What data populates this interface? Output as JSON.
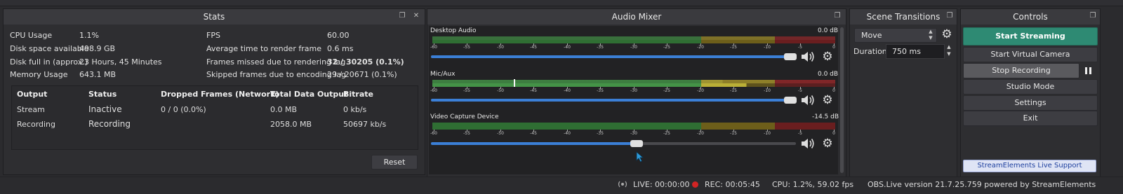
{
  "stats": {
    "title": "Stats",
    "left": [
      {
        "label": "CPU Usage",
        "value": "1.1%"
      },
      {
        "label": "Disk space available",
        "value": "498.9 GB"
      },
      {
        "label": "Disk full in (approx.)",
        "value": "23 Hours, 45 Minutes"
      },
      {
        "label": "Memory Usage",
        "value": "643.1 MB"
      }
    ],
    "right": [
      {
        "label": "FPS",
        "value": "60.00"
      },
      {
        "label": "Average time to render frame",
        "value": "0.6 ms"
      },
      {
        "label": "Frames missed due to rendering lag",
        "value": "32 / 30205 (0.1%)"
      },
      {
        "label": "Skipped frames due to encoding lag",
        "value": "29 / 20671 (0.1%)"
      }
    ],
    "table": {
      "headers": [
        "Output",
        "Status",
        "Dropped Frames (Network)",
        "Total Data Output",
        "Bitrate"
      ],
      "rows": [
        [
          "Stream",
          "Inactive",
          "0 / 0 (0.0%)",
          "0.0 MB",
          "0 kb/s"
        ],
        [
          "Recording",
          "Recording",
          "",
          "2058.0 MB",
          "50697 kb/s"
        ]
      ]
    },
    "reset_label": "Reset"
  },
  "mixer": {
    "title": "Audio Mixer",
    "ticks": [
      "-60",
      "-55",
      "-50",
      "-45",
      "-40",
      "-35",
      "-30",
      "-25",
      "-20",
      "-15",
      "-10",
      "-5",
      "0"
    ],
    "channels": [
      {
        "name": "Desktop Audio",
        "db": "0.0 dB",
        "volume": 1.0
      },
      {
        "name": "Mic/Aux",
        "db": "0.0 dB",
        "volume": 1.0
      },
      {
        "name": "Video Capture Device",
        "db": "-14.5 dB",
        "volume": 0.56
      }
    ]
  },
  "transitions": {
    "title": "Scene Transitions",
    "selected": "Move",
    "duration_label": "Duration",
    "duration_value": "750 ms"
  },
  "controls": {
    "title": "Controls",
    "start_streaming": "Start Streaming",
    "start_virtual_camera": "Start Virtual Camera",
    "stop_recording": "Stop Recording",
    "studio_mode": "Studio Mode",
    "settings": "Settings",
    "exit": "Exit",
    "support": "StreamElements Live Support",
    "accent": "#2e8a73",
    "pause_icon": "pause-icon"
  },
  "statusbar": {
    "live": "LIVE: 00:00:00",
    "rec": "REC: 00:05:45",
    "cpu": "CPU: 1.2%, 59.02 fps",
    "version": "OBS.Live version 21.7.25.759 powered by StreamElements"
  }
}
